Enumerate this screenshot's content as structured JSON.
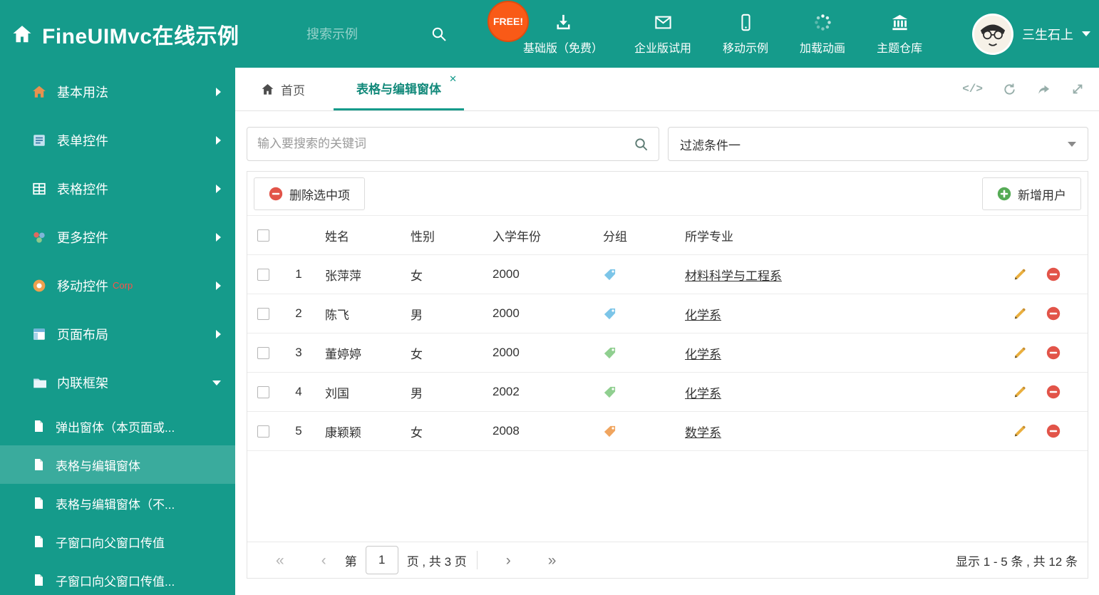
{
  "header": {
    "title": "FineUIMvc在线示例",
    "search_placeholder": "搜索示例",
    "free_badge": "FREE!",
    "nav": [
      {
        "label": "基础版（免费）",
        "icon": "download-icon"
      },
      {
        "label": "企业版试用",
        "icon": "envelope-icon"
      },
      {
        "label": "移动示例",
        "icon": "mobile-icon"
      },
      {
        "label": "加载动画",
        "icon": "spinner-icon"
      },
      {
        "label": "主题仓库",
        "icon": "bank-icon"
      }
    ],
    "user_name": "三生石上"
  },
  "sidebar": {
    "items": [
      {
        "label": "基本用法",
        "icon": "house-icon"
      },
      {
        "label": "表单控件",
        "icon": "form-icon"
      },
      {
        "label": "表格控件",
        "icon": "grid-icon"
      },
      {
        "label": "更多控件",
        "icon": "widgets-icon"
      },
      {
        "label": "移动控件",
        "icon": "signal-icon",
        "badge": "Corp"
      },
      {
        "label": "页面布局",
        "icon": "layout-icon"
      },
      {
        "label": "内联框架",
        "icon": "folder-icon",
        "expanded": true
      }
    ],
    "subitems": [
      {
        "label": "弹出窗体（本页面或..."
      },
      {
        "label": "表格与编辑窗体",
        "active": true
      },
      {
        "label": "表格与编辑窗体（不..."
      },
      {
        "label": "子窗口向父窗口传值"
      },
      {
        "label": "子窗口向父窗口传值..."
      }
    ]
  },
  "tabs": {
    "home_label": "首页",
    "active_label": "表格与编辑窗体",
    "close_glyph": "✕",
    "code_glyph": "</>"
  },
  "filter": {
    "search_placeholder": "输入要搜索的关键词",
    "dropdown_value": "过滤条件一"
  },
  "toolbar": {
    "delete_label": "删除选中项",
    "add_label": "新增用户"
  },
  "table": {
    "headers": {
      "name": "姓名",
      "gender": "性别",
      "year": "入学年份",
      "group": "分组",
      "major": "所学专业"
    },
    "rows": [
      {
        "num": "1",
        "name": "张萍萍",
        "gender": "女",
        "year": "2000",
        "tag_color": "#7cc5e8",
        "major": "材料科学与工程系"
      },
      {
        "num": "2",
        "name": "陈飞",
        "gender": "男",
        "year": "2000",
        "tag_color": "#7cc5e8",
        "major": "化学系"
      },
      {
        "num": "3",
        "name": "董婷婷",
        "gender": "女",
        "year": "2000",
        "tag_color": "#90cf90",
        "major": "化学系"
      },
      {
        "num": "4",
        "name": "刘国",
        "gender": "男",
        "year": "2002",
        "tag_color": "#90cf90",
        "major": "化学系"
      },
      {
        "num": "5",
        "name": "康颖颖",
        "gender": "女",
        "year": "2008",
        "tag_color": "#f0a55f",
        "major": "数学系"
      }
    ]
  },
  "pagination": {
    "icons": {
      "first": "«",
      "prev": "‹",
      "next": "›",
      "last": "»"
    },
    "page_prefix": "第",
    "page_value": "1",
    "page_suffix": "页 , 共 3 页",
    "summary": "显示 1 - 5 条 , 共 12 条"
  },
  "colors": {
    "theme_green": "#159b8b",
    "free_badge_orange": "#f95a17",
    "delete_red": "#e25449",
    "add_green": "#56ab56",
    "corp_badge_red": "#ff5147"
  }
}
